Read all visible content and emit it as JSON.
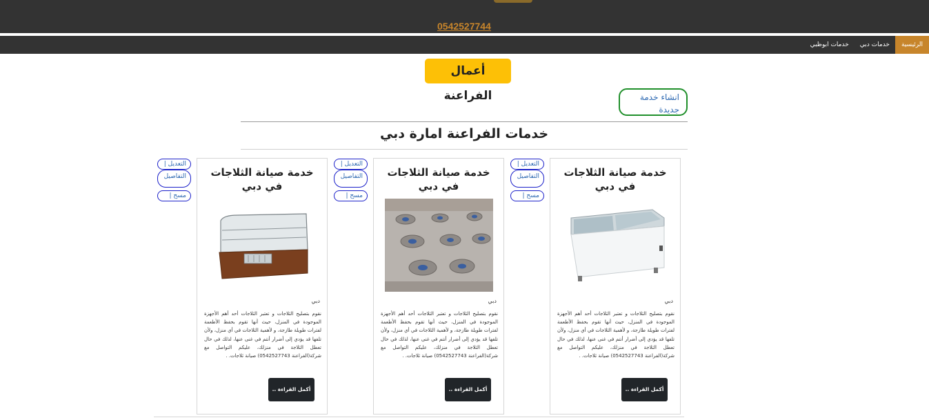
{
  "header": {
    "phone": "0542527744"
  },
  "nav": {
    "items": [
      {
        "label": "الرئيسية",
        "active": true
      },
      {
        "label": "خدمات دبي",
        "active": false
      },
      {
        "label": "خدمات ابوظبي",
        "active": false
      }
    ]
  },
  "page": {
    "title": "أعمال الفراعنة",
    "create_label": "انشاء خدمة جديدة",
    "section_title": "خدمات الفراعنة امارة دبي"
  },
  "actions": {
    "edit_label": "التعديل  |",
    "details_label": "التفاصيل",
    "delete_label": "مسح  |"
  },
  "cards": [
    {
      "title": "خدمة صيانة الثلاجات في دبي",
      "image": "chest-freezer-image",
      "city": "دبي",
      "description": "نقوم بتصليح الثلاجات و تعتبر الثلاجات أحد أهم الأجهزة الموجودة في المنزل، حيث أنها تقوم بحفظ الأطعمة لفترات طويلة طازجة، و لأهمية الثلاجات في أي منزل، ولأن تلفها قد يؤدي إلى أضرار أنتم في غنى عنها، لذلك في حال تعطل الثلاجة في منزلك، عليكم التواصل مع شركة(الفراعنة 0542527743) صيانة ثلاجات. .",
      "read_more": "أكمل القراءة .."
    },
    {
      "title": "خدمة صيانة الثلاجات في دبي",
      "image": "gas-stove-image",
      "city": "دبي",
      "description": "نقوم بتصليح الثلاجات و تعتبر الثلاجات أحد أهم الأجهزة الموجودة في المنزل، حيث أنها تقوم بحفظ الأطعمة لفترات طويلة طازجة، و لأهمية الثلاجات في أي منزل، ولأن تلفها قد يؤدي إلى أضرار أنتم في غنى عنها، لذلك في حال تعطل الثلاجة في منزلك، عليكم التواصل مع شركة(الفراعنة 0542527743) صيانة ثلاجات. .",
      "read_more": "أكمل القراءة .."
    },
    {
      "title": "خدمة صيانة الثلاجات في دبي",
      "image": "display-fridge-image",
      "city": "دبي",
      "description": "نقوم بتصليح الثلاجات و تعتبر الثلاجات أحد أهم الأجهزة الموجودة في المنزل، حيث أنها تقوم بحفظ الأطعمة لفترات طويلة طازجة، و لأهمية الثلاجات في أي منزل، ولأن تلفها قد يؤدي إلى أضرار أنتم في غنى عنها، لذلك في حال تعطل الثلاجة في منزلك، عليكم التواصل مع شركة(الفراعنة 0542527743) صيانة ثلاجات. .",
      "read_more": "أكمل القراءة .."
    }
  ],
  "colors": {
    "header_bg": "#333333",
    "accent": "#c7852b",
    "title_badge": "#fdc006",
    "create_border": "#1f8f2a",
    "link": "#2b67b1",
    "pill_border": "#1a1fc9",
    "button_dark": "#212529"
  }
}
